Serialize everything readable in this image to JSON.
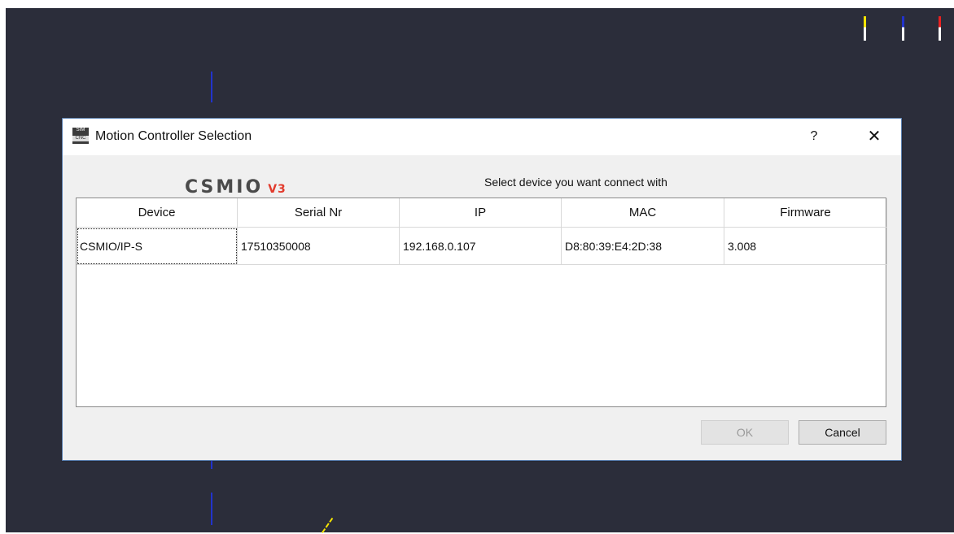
{
  "window": {
    "title": "Motion Controller Selection",
    "help_label": "?",
    "close_label": "✕",
    "icon_top_text": "SIM",
    "icon_bottom_text": "CNC"
  },
  "logo": {
    "main": "CSMIO",
    "version": "V3"
  },
  "prompt": "Select device you want connect with",
  "table": {
    "columns": [
      "Device",
      "Serial Nr",
      "IP",
      "MAC",
      "Firmware"
    ],
    "rows": [
      [
        "CSMIO/IP-S",
        "17510350008",
        "192.168.0.107",
        "D8:80:39:E4:2D:38",
        "3.008"
      ]
    ]
  },
  "buttons": {
    "ok": "OK",
    "cancel": "Cancel"
  },
  "colors": {
    "viewport_bg": "#2b2d3a",
    "axis_yellow": "#f5e400",
    "axis_blue": "#2233cc",
    "axis_red": "#e82020",
    "logo_accent": "#e23a2c"
  }
}
